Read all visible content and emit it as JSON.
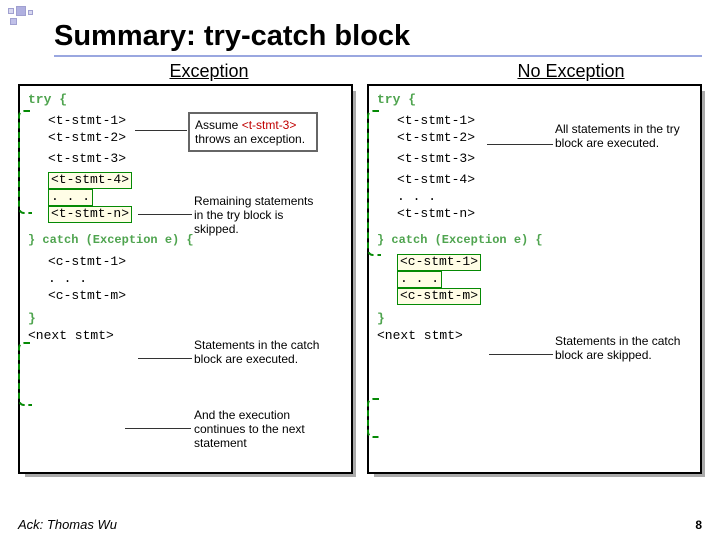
{
  "slide": {
    "title": "Summary: try-catch block",
    "heading_left": "Exception",
    "heading_right": "No Exception",
    "ack": "Ack: Thomas Wu",
    "page": "8"
  },
  "code": {
    "try": "try {",
    "t1": "<t-stmt-1>",
    "t2": "<t-stmt-2>",
    "t3": "<t-stmt-3>",
    "t4": "<t-stmt-4>",
    "dots": ". . .",
    "tn": "<t-stmt-n>",
    "catch": "} catch (Exception e) {",
    "c1": "<c-stmt-1>",
    "cm": "<c-stmt-m>",
    "closeBrace": "}",
    "next": "<next stmt>"
  },
  "callouts": {
    "left": {
      "assume_pre": "Assume ",
      "assume_ref": "<t-stmt-3>",
      "assume_post": " throws an exception.",
      "remaining": "Remaining statements in the try block is skipped.",
      "catchExec": "Statements in the catch block are executed.",
      "continue": "And the execution continues to the next statement"
    },
    "right": {
      "allExec": "All statements in the try block are executed.",
      "catchSkip": "Statements in the catch block are skipped."
    }
  }
}
